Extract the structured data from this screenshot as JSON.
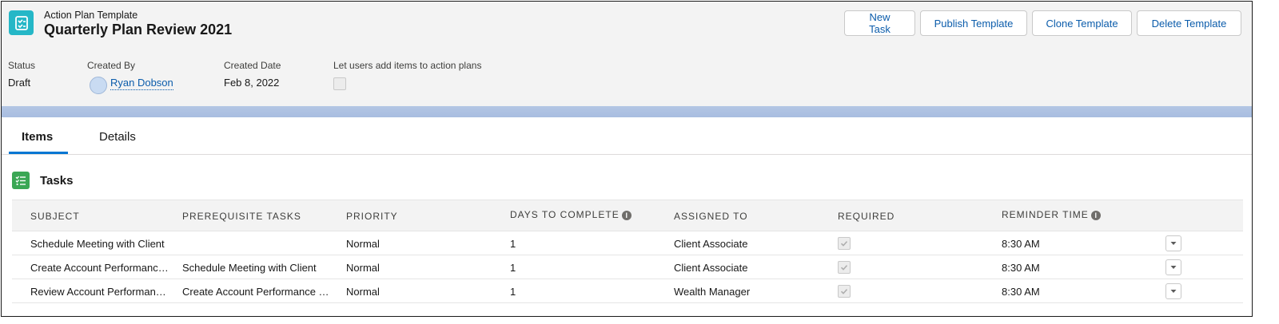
{
  "header": {
    "eyebrow": "Action Plan Template",
    "title": "Quarterly Plan Review 2021",
    "icon": "action-plan-icon",
    "actions": [
      "New Task",
      "Publish Template",
      "Clone Template",
      "Delete Template"
    ]
  },
  "fields": {
    "status_label": "Status",
    "status_value": "Draft",
    "created_by_label": "Created By",
    "created_by_value": "Ryan Dobson",
    "created_date_label": "Created Date",
    "created_date_value": "Feb 8, 2022",
    "allow_items_label": "Let users add items to action plans",
    "allow_items_checked": false
  },
  "tabs": [
    {
      "label": "Items",
      "active": true
    },
    {
      "label": "Details",
      "active": false
    }
  ],
  "tasks": {
    "title": "Tasks",
    "icon": "task-list-icon",
    "columns": [
      "SUBJECT",
      "PREREQUISITE TASKS",
      "PRIORITY",
      "DAYS TO COMPLETE",
      "ASSIGNED TO",
      "REQUIRED",
      "REMINDER TIME"
    ],
    "rows": [
      {
        "subject": "Schedule Meeting with Client",
        "prerequisite": "",
        "priority": "Normal",
        "days": "1",
        "assigned": "Client Associate",
        "required": true,
        "reminder": "8:30 AM"
      },
      {
        "subject": "Create Account Performance Report",
        "prerequisite": "Schedule Meeting with Client",
        "priority": "Normal",
        "days": "1",
        "assigned": "Client Associate",
        "required": true,
        "reminder": "8:30 AM"
      },
      {
        "subject": "Review Account Performance Report",
        "prerequisite": "Create Account Performance Report",
        "priority": "Normal",
        "days": "1",
        "assigned": "Wealth Manager",
        "required": true,
        "reminder": "8:30 AM"
      }
    ]
  },
  "colors": {
    "brand_link": "#0b5cab",
    "header_icon_bg": "#25b7c7",
    "tasks_icon_bg": "#3ba755",
    "tab_accent": "#0176d3"
  }
}
